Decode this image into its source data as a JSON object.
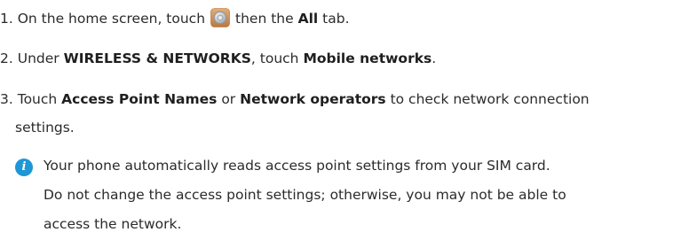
{
  "steps": [
    {
      "number": "1.",
      "text_a": "On the home screen, touch",
      "text_b": "then the",
      "bold_a": "All",
      "text_c": "tab."
    },
    {
      "number": "2.",
      "text_a": "Under",
      "bold_a": "WIRELESS & NETWORKS",
      "text_b": ", touch",
      "bold_b": "Mobile networks",
      "text_c": "."
    },
    {
      "number": "3.",
      "text_a": "Touch",
      "bold_a": "Access Point Names",
      "text_b": "or",
      "bold_b": "Network operators",
      "text_c": "to check network connection",
      "text_d": "settings."
    }
  ],
  "note": {
    "icon": "info-icon",
    "icon_glyph": "i",
    "icon_color": "#1d97d6",
    "lines": [
      "Your phone automatically reads access point settings from your SIM card.",
      "Do not change the access point settings; otherwise, you may not be able to",
      "access the network."
    ]
  },
  "icons": {
    "settings": "settings-gear-icon"
  }
}
